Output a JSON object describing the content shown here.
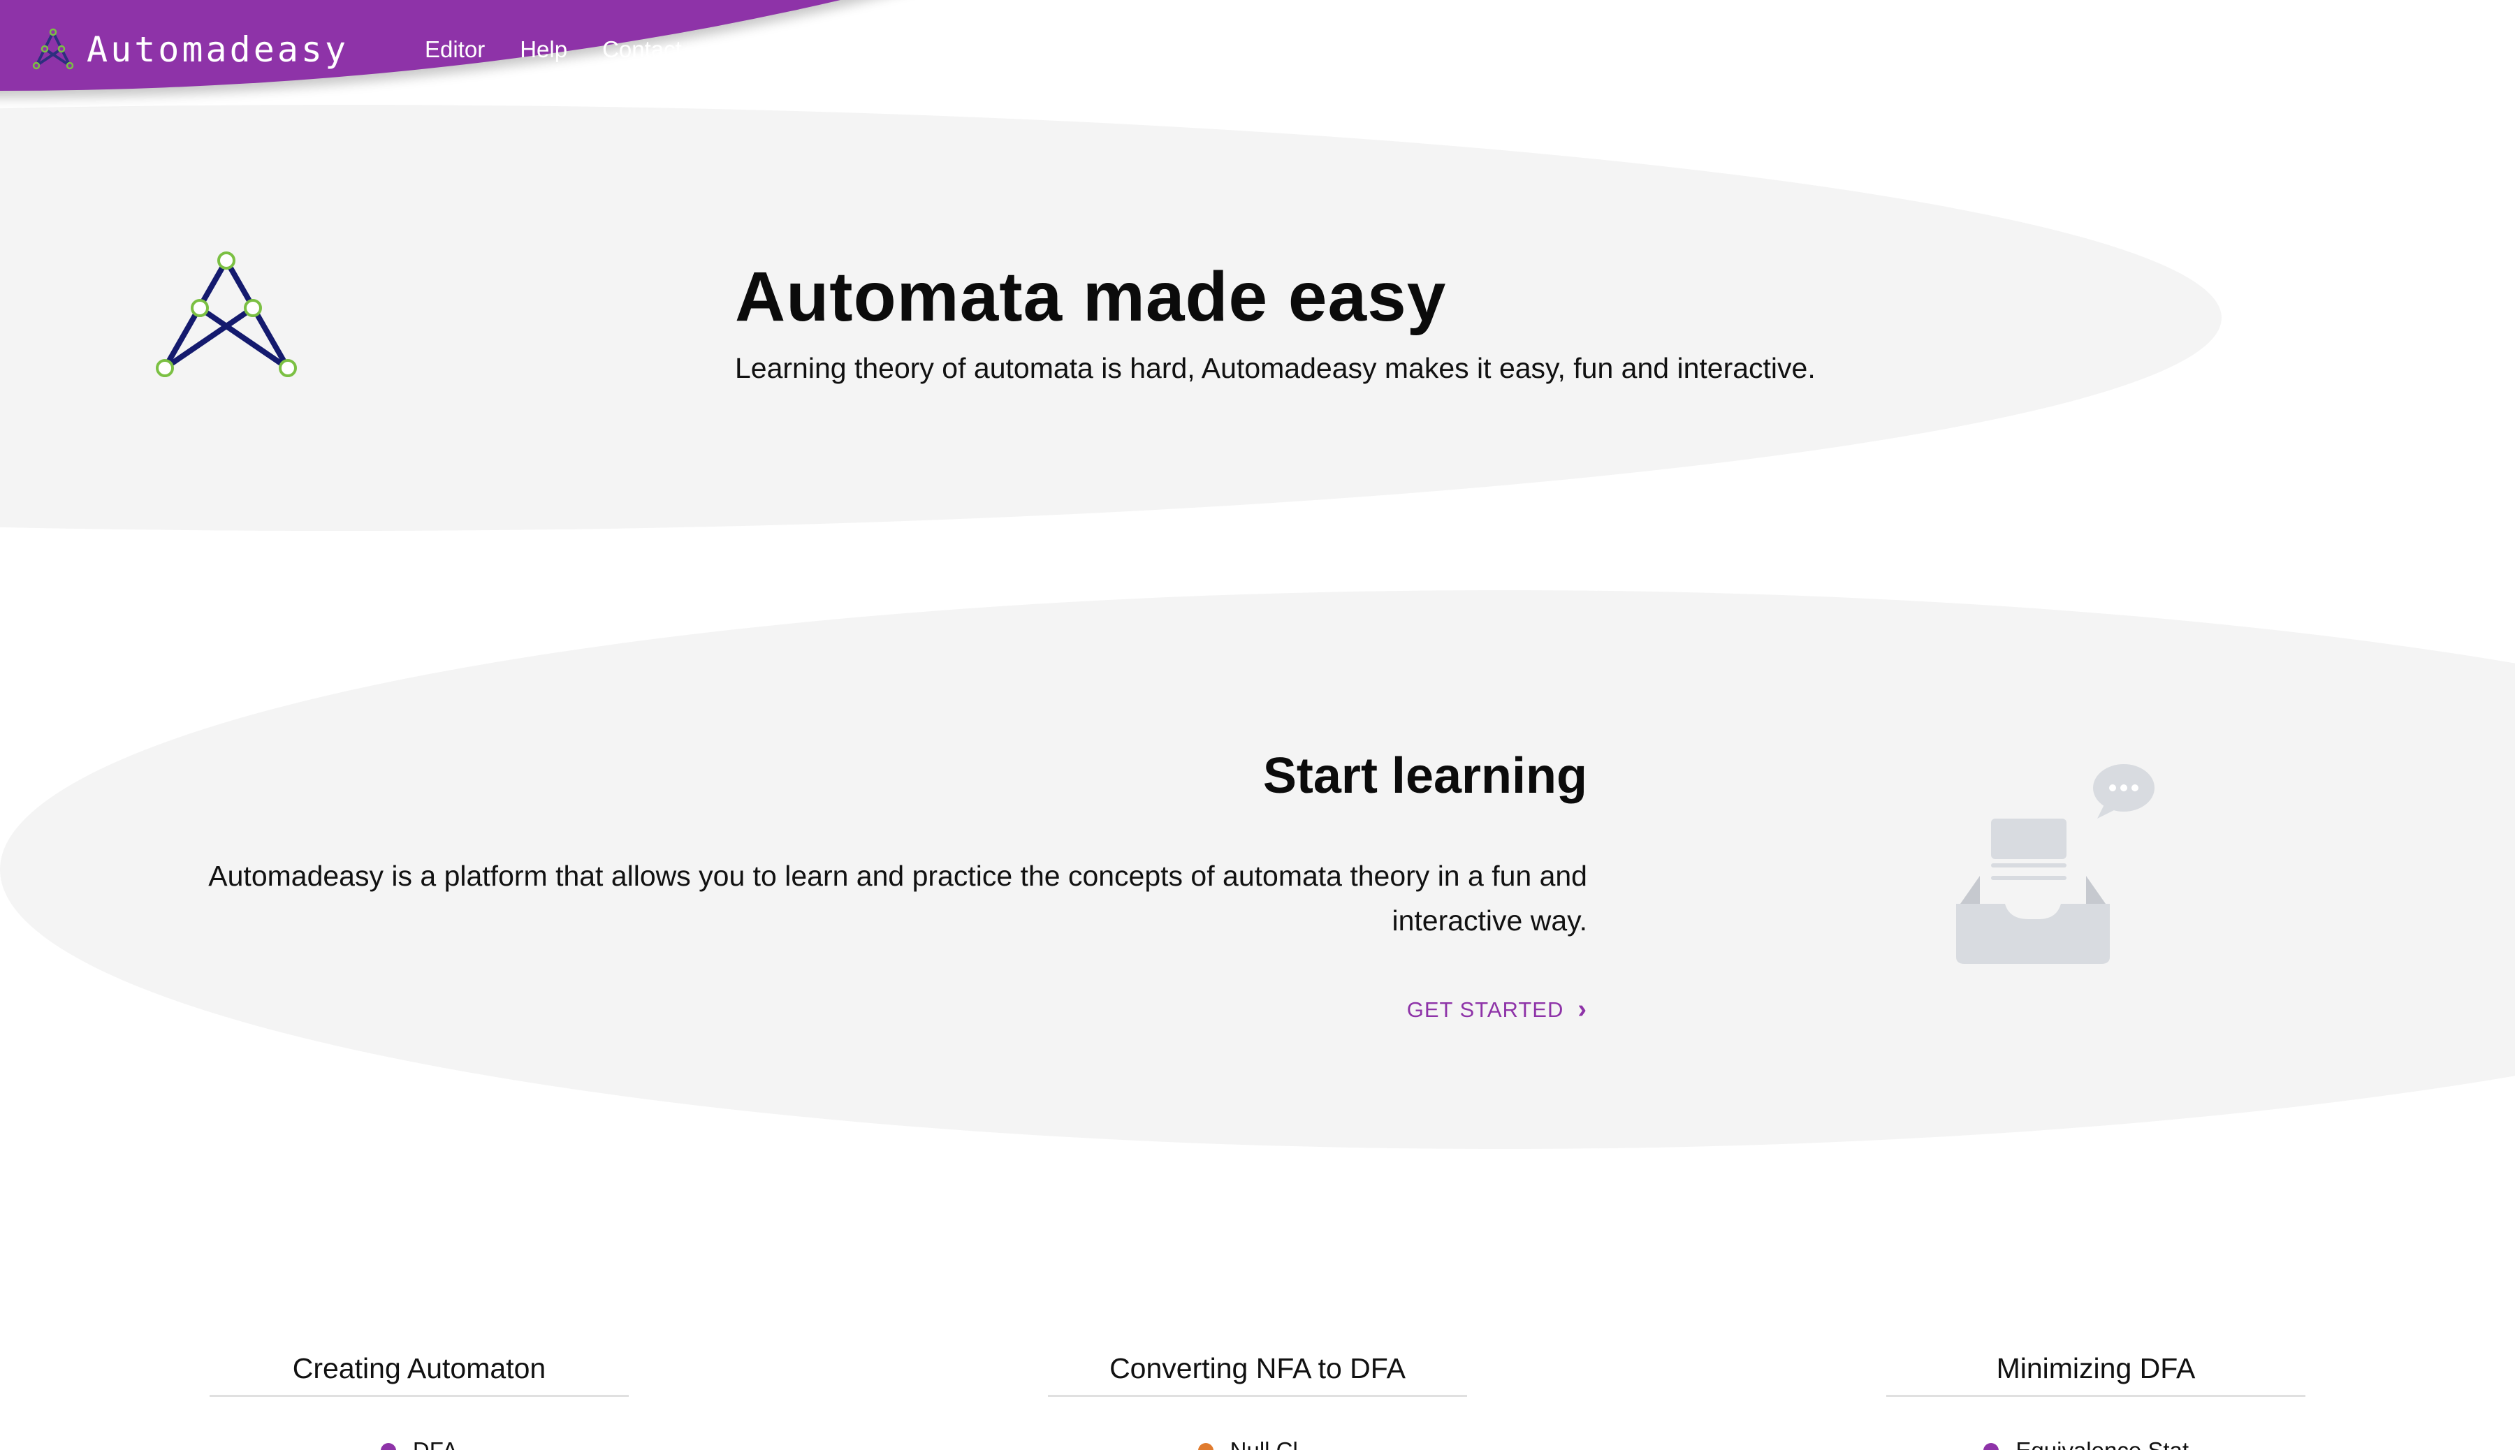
{
  "app": {
    "brand": "Automadeasy",
    "logo_icon": "automaton-logo-icon"
  },
  "nav": {
    "items": [
      "Editor",
      "Help",
      "Contact"
    ]
  },
  "hero": {
    "title": "Automata made easy",
    "subtitle": "Learning theory of automata is hard, Automadeasy makes it easy, fun and interactive."
  },
  "start": {
    "title": "Start learning",
    "text": "Automadeasy is a platform that allows you to learn and practice the concepts of automata theory in a fun and interactive way.",
    "cta": "GET STARTED",
    "cta_icon": "chevron-right-icon",
    "illustration": "inbox-chat-illustration"
  },
  "features": [
    {
      "title": "Creating Automaton",
      "first_item": "DFA",
      "dot_color": "#8e33a8"
    },
    {
      "title": "Converting NFA to DFA",
      "first_item": "Null Cl...",
      "dot_color": "#e07b2e"
    },
    {
      "title": "Minimizing DFA",
      "first_item": "Equivalence Stat...",
      "dot_color": "#8e33a8"
    }
  ],
  "colors": {
    "brand": "#8e33a8",
    "blob": "#f4f4f4",
    "logo_stroke": "#141a6e",
    "logo_node": "#7bc043"
  }
}
